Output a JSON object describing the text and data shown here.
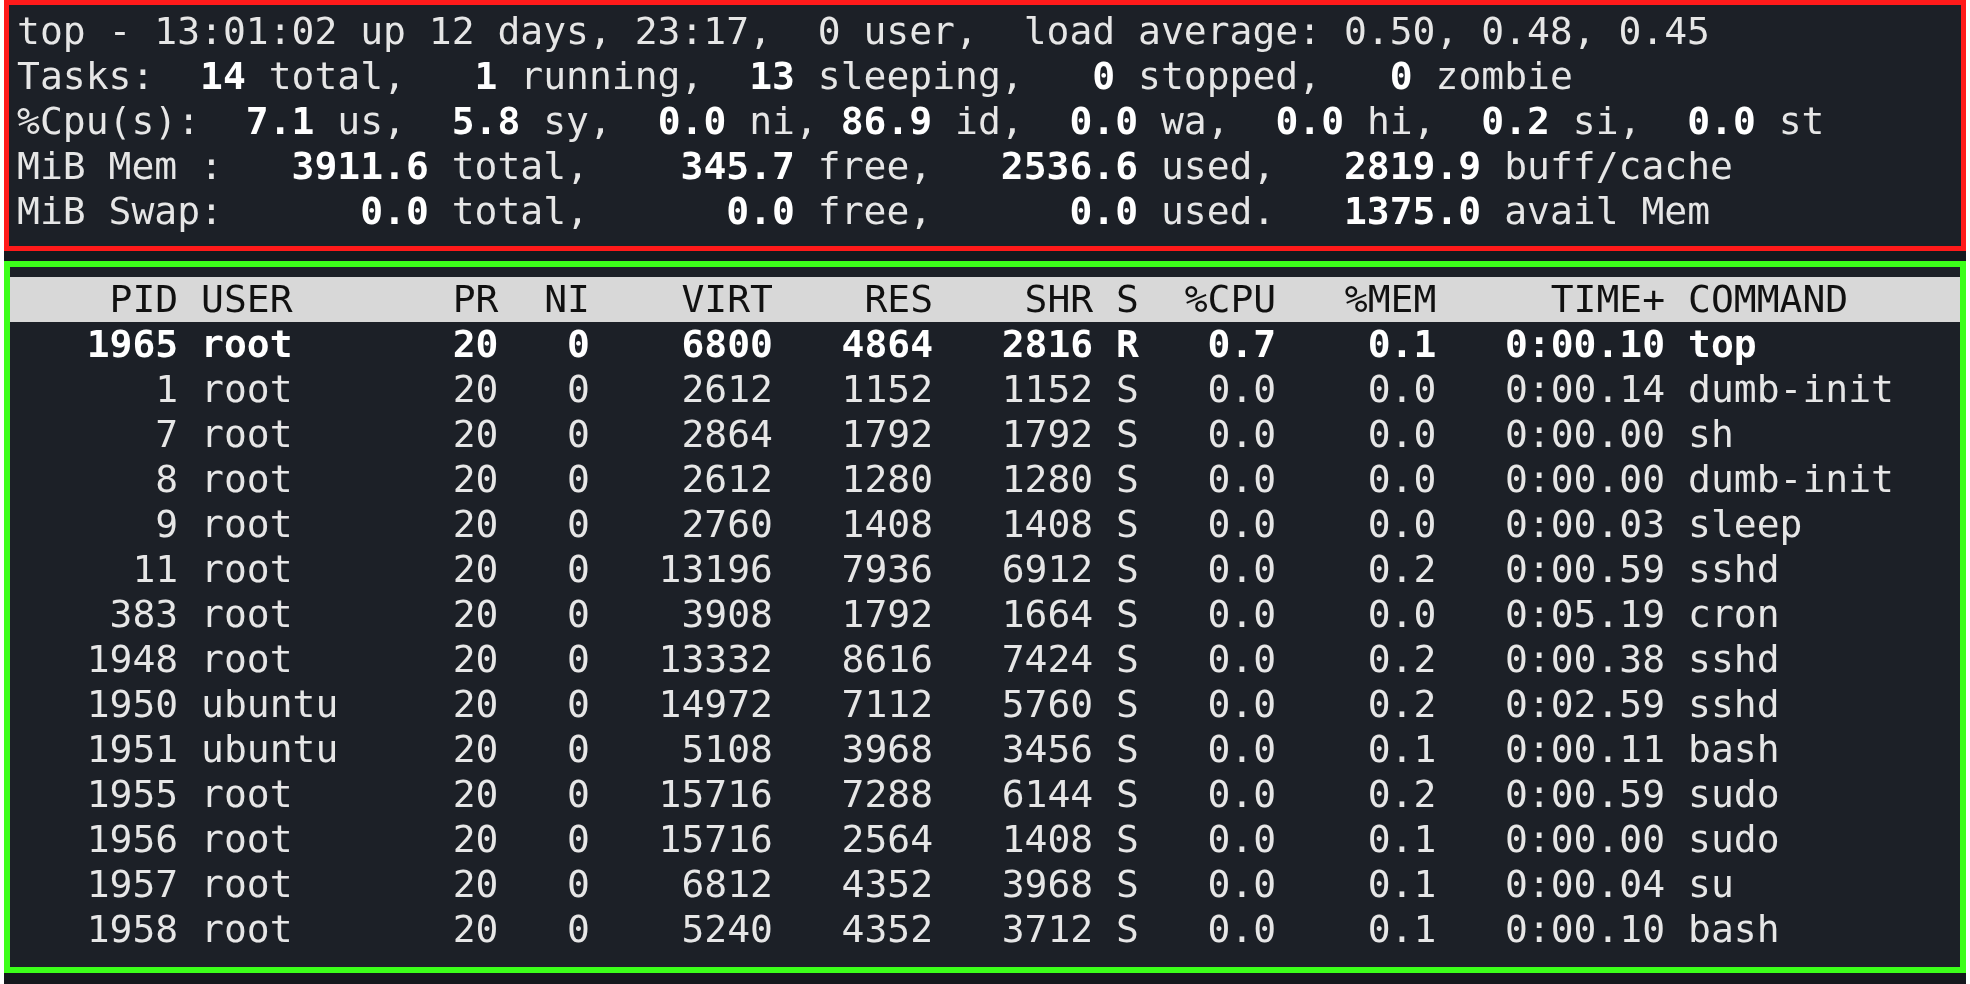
{
  "summary": {
    "lines": [
      "top - 13:01:02 up 12 days, 23:17,  0 user,  load average: 0.50, 0.48, 0.45",
      "Tasks:  **14** total,   **1** running,  **13** sleeping,   **0** stopped,   **0** zombie",
      "%Cpu(s):  **7.1** us,  **5.8** sy,  **0.0** ni, **86.9** id,  **0.0** wa,  **0.0** hi,  **0.2** si,  **0.0** st",
      "MiB Mem :   **3911.6** total,    **345.7** free,   **2536.6** used,   **2819.9** buff/cache",
      "MiB Swap:      **0.0** total,      **0.0** free,      **0.0** used.   **1375.0** avail Mem"
    ]
  },
  "process_table": {
    "columns": [
      "PID",
      "USER",
      "PR",
      "NI",
      "VIRT",
      "RES",
      "SHR",
      "S",
      "%CPU",
      "%MEM",
      "TIME+",
      "COMMAND"
    ],
    "rows": [
      {
        "highlighted": true,
        "cells": [
          "1965",
          "root",
          "20",
          "0",
          "6800",
          "4864",
          "2816",
          "R",
          "0.7",
          "0.1",
          "0:00.10",
          "top"
        ]
      },
      {
        "highlighted": false,
        "cells": [
          "1",
          "root",
          "20",
          "0",
          "2612",
          "1152",
          "1152",
          "S",
          "0.0",
          "0.0",
          "0:00.14",
          "dumb-init"
        ]
      },
      {
        "highlighted": false,
        "cells": [
          "7",
          "root",
          "20",
          "0",
          "2864",
          "1792",
          "1792",
          "S",
          "0.0",
          "0.0",
          "0:00.00",
          "sh"
        ]
      },
      {
        "highlighted": false,
        "cells": [
          "8",
          "root",
          "20",
          "0",
          "2612",
          "1280",
          "1280",
          "S",
          "0.0",
          "0.0",
          "0:00.00",
          "dumb-init"
        ]
      },
      {
        "highlighted": false,
        "cells": [
          "9",
          "root",
          "20",
          "0",
          "2760",
          "1408",
          "1408",
          "S",
          "0.0",
          "0.0",
          "0:00.03",
          "sleep"
        ]
      },
      {
        "highlighted": false,
        "cells": [
          "11",
          "root",
          "20",
          "0",
          "13196",
          "7936",
          "6912",
          "S",
          "0.0",
          "0.2",
          "0:00.59",
          "sshd"
        ]
      },
      {
        "highlighted": false,
        "cells": [
          "383",
          "root",
          "20",
          "0",
          "3908",
          "1792",
          "1664",
          "S",
          "0.0",
          "0.0",
          "0:05.19",
          "cron"
        ]
      },
      {
        "highlighted": false,
        "cells": [
          "1948",
          "root",
          "20",
          "0",
          "13332",
          "8616",
          "7424",
          "S",
          "0.0",
          "0.2",
          "0:00.38",
          "sshd"
        ]
      },
      {
        "highlighted": false,
        "cells": [
          "1950",
          "ubuntu",
          "20",
          "0",
          "14972",
          "7112",
          "5760",
          "S",
          "0.0",
          "0.2",
          "0:02.59",
          "sshd"
        ]
      },
      {
        "highlighted": false,
        "cells": [
          "1951",
          "ubuntu",
          "20",
          "0",
          "5108",
          "3968",
          "3456",
          "S",
          "0.0",
          "0.1",
          "0:00.11",
          "bash"
        ]
      },
      {
        "highlighted": false,
        "cells": [
          "1955",
          "root",
          "20",
          "0",
          "15716",
          "7288",
          "6144",
          "S",
          "0.0",
          "0.2",
          "0:00.59",
          "sudo"
        ]
      },
      {
        "highlighted": false,
        "cells": [
          "1956",
          "root",
          "20",
          "0",
          "15716",
          "2564",
          "1408",
          "S",
          "0.0",
          "0.1",
          "0:00.00",
          "sudo"
        ]
      },
      {
        "highlighted": false,
        "cells": [
          "1957",
          "root",
          "20",
          "0",
          "6812",
          "4352",
          "3968",
          "S",
          "0.0",
          "0.1",
          "0:00.04",
          "su"
        ]
      },
      {
        "highlighted": false,
        "cells": [
          "1958",
          "root",
          "20",
          "0",
          "5240",
          "4352",
          "3712",
          "S",
          "0.0",
          "0.1",
          "0:00.10",
          "bash"
        ]
      }
    ]
  }
}
